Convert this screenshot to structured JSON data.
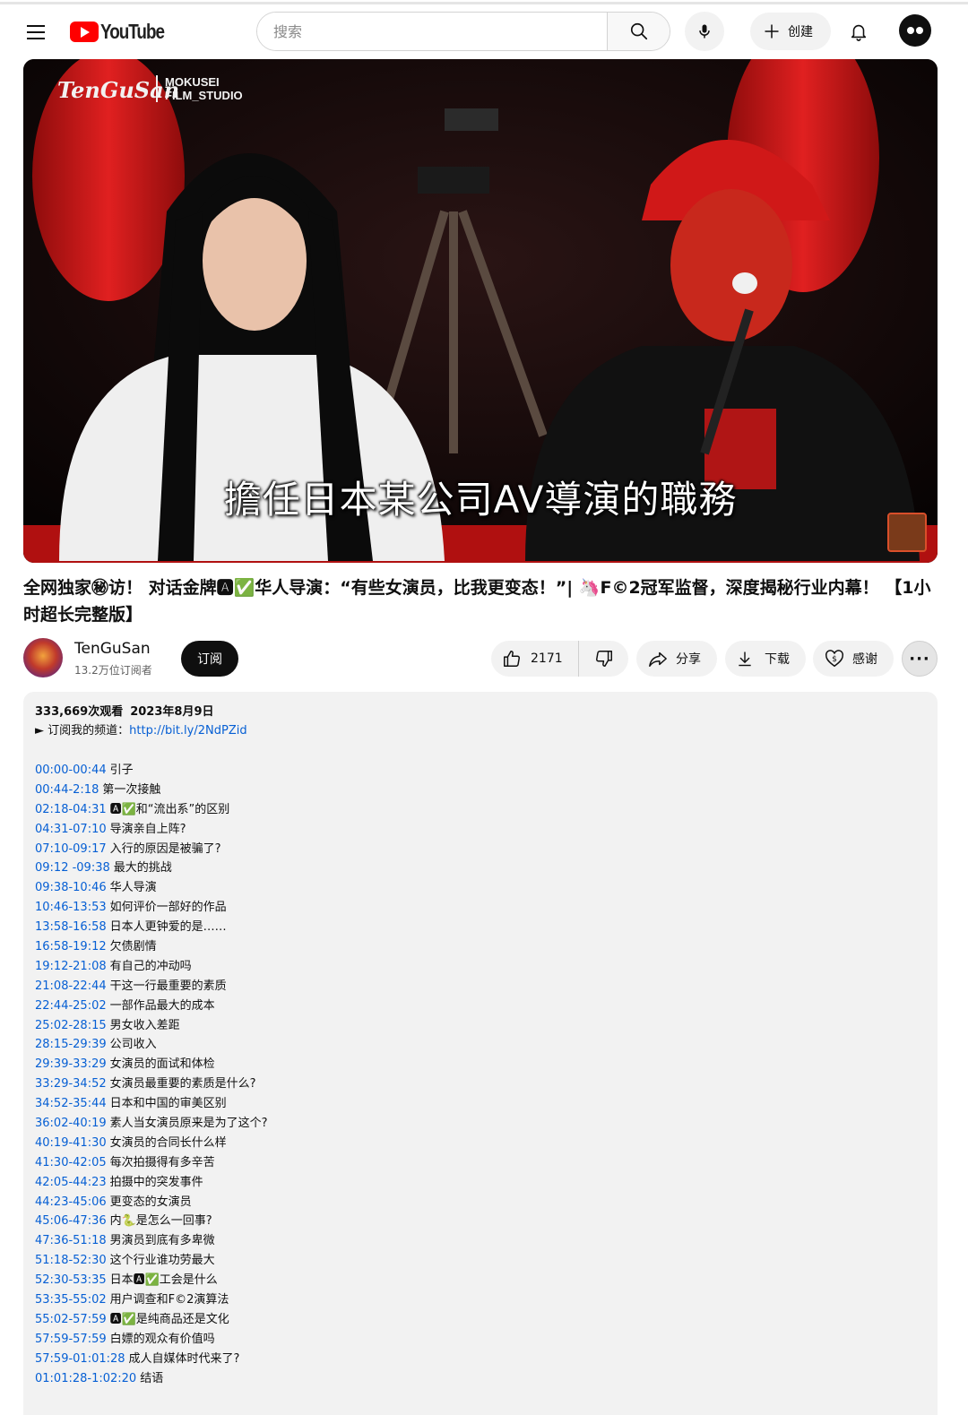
{
  "header": {
    "logo_text": "YouTube",
    "search_placeholder": "搜索",
    "create_label": "创建"
  },
  "video": {
    "brand_name": "TenGuSan",
    "brand_studio_line1": "MOKUSEI",
    "brand_studio_line2": "FILM_STUDIO",
    "subtitle": "擔任日本某公司AV導演的職務"
  },
  "title": "全网独家㊙访！ 对话金牌🅰✅华人导演：“有些女演员，比我更变态！”| 🦄F©2冠军监督，深度揭秘行业内幕！ 【1小时超长完整版】",
  "channel": {
    "name": "TenGuSan",
    "subscribers": "13.2万位订阅者",
    "subscribe_label": "订阅"
  },
  "actions": {
    "like_count": "2171",
    "share_label": "分享",
    "download_label": "下载",
    "thanks_label": "感谢",
    "more_label": "···"
  },
  "description": {
    "views": "333,669次观看",
    "date": "2023年8月9日",
    "promo_text": "► 订阅我的频道：",
    "promo_link": "http://bit.ly/2NdPZid",
    "chapters": [
      {
        "ts": "00:00-00:44",
        "text": "引子"
      },
      {
        "ts": "00:44-2:18",
        "text": "第一次接触"
      },
      {
        "ts": "02:18-04:31",
        "text": "🅰✅和“流出系”的区别"
      },
      {
        "ts": "04:31-07:10",
        "text": "导演亲自上阵?"
      },
      {
        "ts": "07:10-09:17",
        "text": "入行的原因是被骗了?"
      },
      {
        "ts": "09:12 -09:38",
        "text": "最大的挑战"
      },
      {
        "ts": "09:38-10:46",
        "text": "华人导演"
      },
      {
        "ts": "10:46-13:53",
        "text": "如何评价一部好的作品"
      },
      {
        "ts": "13:58-16:58",
        "text": "日本人更钟爱的是……"
      },
      {
        "ts": "16:58-19:12",
        "text": "欠债剧情"
      },
      {
        "ts": "19:12-21:08",
        "text": "有自己的冲动吗"
      },
      {
        "ts": "21:08-22:44",
        "text": "干这一行最重要的素质"
      },
      {
        "ts": "22:44-25:02",
        "text": "一部作品最大的成本"
      },
      {
        "ts": "25:02-28:15",
        "text": "男女收入差距"
      },
      {
        "ts": "28:15-29:39",
        "text": "公司收入"
      },
      {
        "ts": "29:39-33:29",
        "text": "女演员的面试和体检"
      },
      {
        "ts": "33:29-34:52",
        "text": "女演员最重要的素质是什么?"
      },
      {
        "ts": "34:52-35:44",
        "text": "日本和中国的审美区别"
      },
      {
        "ts": "36:02-40:19",
        "text": "素人当女演员原来是为了这个?"
      },
      {
        "ts": "40:19-41:30",
        "text": "女演员的合同长什么样"
      },
      {
        "ts": "41:30-42:05",
        "text": "每次拍摄得有多辛苦"
      },
      {
        "ts": "42:05-44:23",
        "text": "拍摄中的突发事件"
      },
      {
        "ts": "44:23-45:06",
        "text": "更变态的女演员"
      },
      {
        "ts": "45:06-47:36",
        "text": "内🐍是怎么一回事?"
      },
      {
        "ts": "47:36-51:18",
        "text": "男演员到底有多卑微"
      },
      {
        "ts": "51:18-52:30",
        "text": "这个行业谁功劳最大"
      },
      {
        "ts": "52:30-53:35",
        "text": "日本🅰✅工会是什么"
      },
      {
        "ts": "53:35-55:02",
        "text": "用户调查和F©2演算法"
      },
      {
        "ts": "55:02-57:59",
        "text": "🅰✅是纯商品还是文化"
      },
      {
        "ts": "57:59-57:59",
        "text": "白嫖的观众有价值吗"
      },
      {
        "ts": "57:59-01:01:28",
        "text": "成人自媒体时代来了?"
      },
      {
        "ts": "01:01:28-1:02:20",
        "text": "结语"
      }
    ]
  },
  "colors": {
    "brand_red": "#ff0000",
    "link_blue": "#065fd4",
    "desc_bg": "#f2f2f2"
  },
  "icons": [
    "menu-icon",
    "youtube-logo-icon",
    "search-icon",
    "mic-icon",
    "plus-icon",
    "bell-icon",
    "avatar-icon",
    "thumb-up-icon",
    "thumb-down-icon",
    "share-icon",
    "download-icon",
    "thanks-icon",
    "more-icon"
  ]
}
